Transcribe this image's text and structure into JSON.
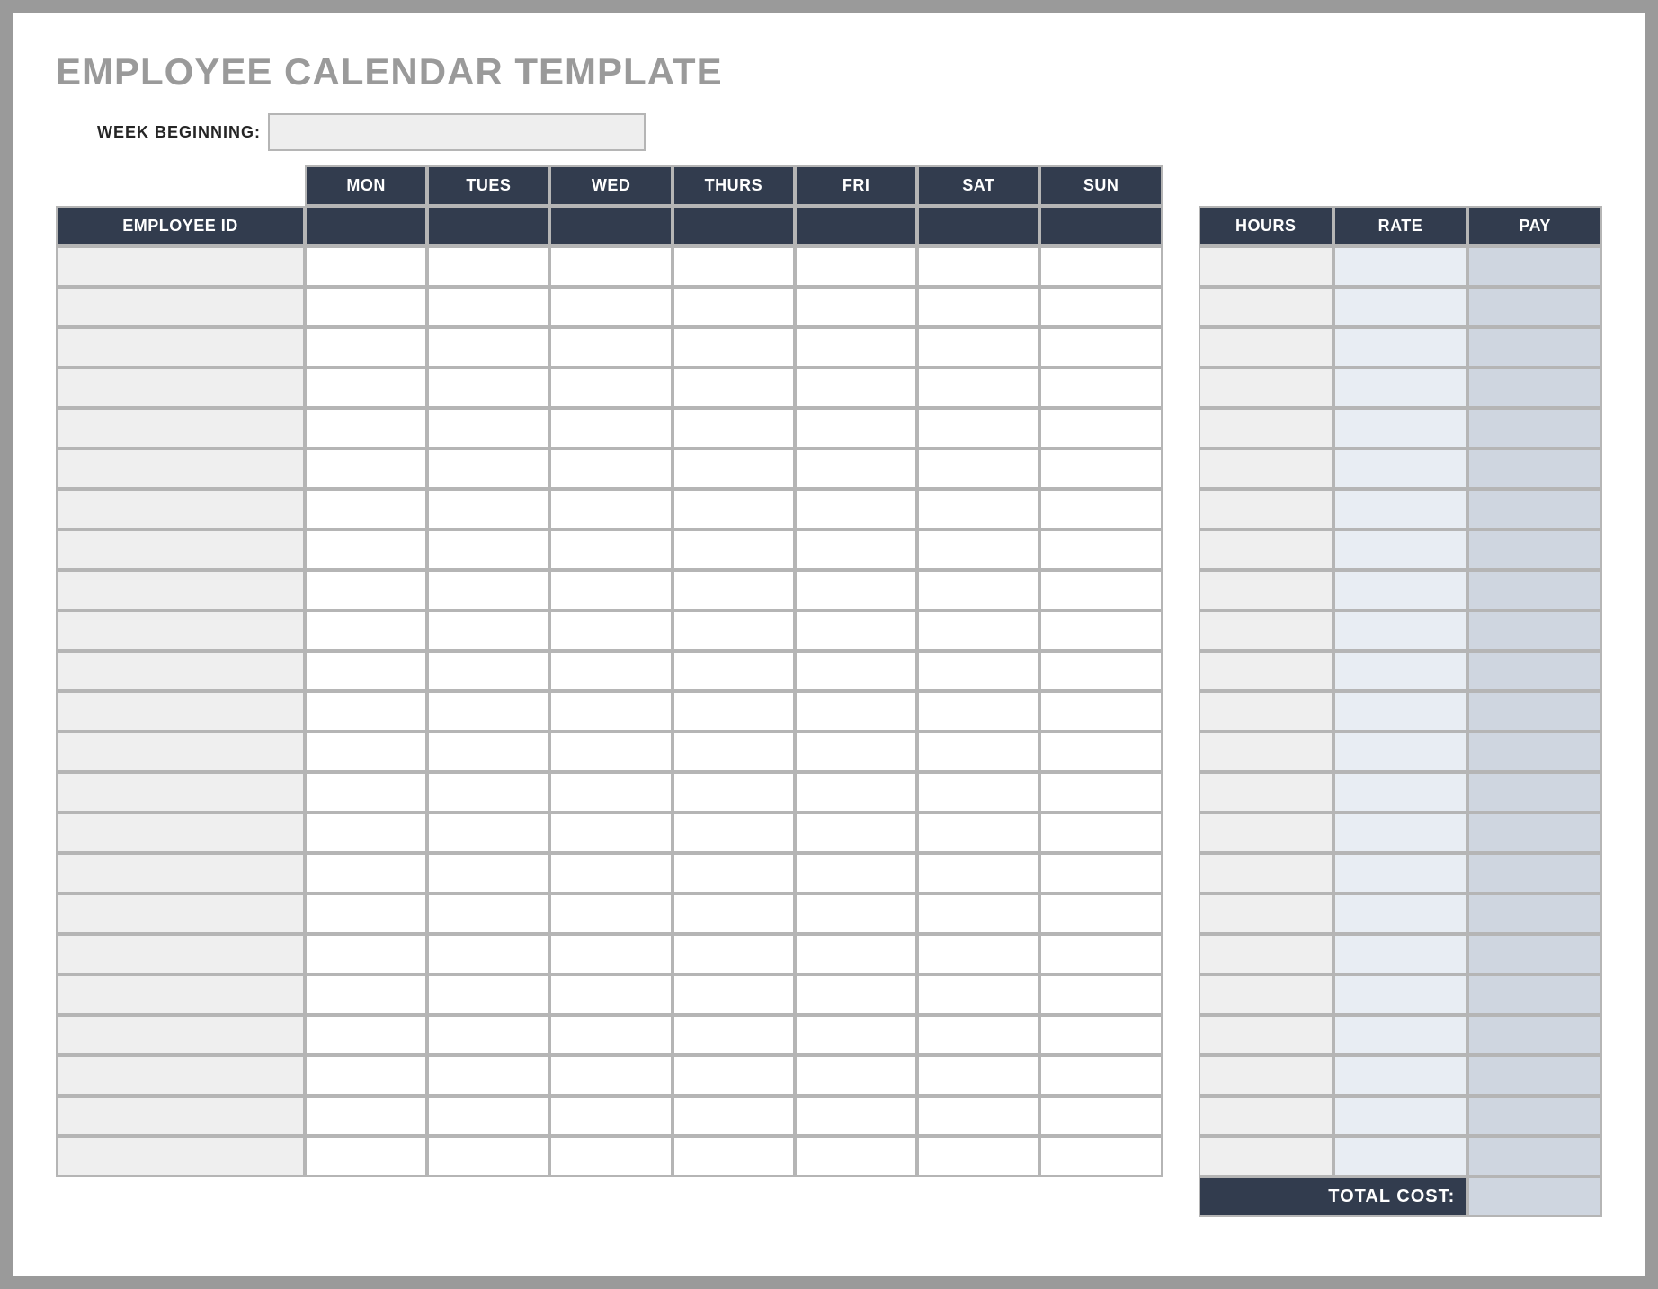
{
  "title": "EMPLOYEE CALENDAR TEMPLATE",
  "week_beginning_label": "WEEK BEGINNING:",
  "week_beginning_value": "",
  "days": [
    "MON",
    "TUES",
    "WED",
    "THURS",
    "FRI",
    "SAT",
    "SUN"
  ],
  "headers": {
    "employee_id": "EMPLOYEE ID",
    "hours": "HOURS",
    "rate": "RATE",
    "pay": "PAY"
  },
  "rows": [
    {
      "employee_id": "",
      "days": [
        "",
        "",
        "",
        "",
        "",
        "",
        ""
      ],
      "hours": "",
      "rate": "",
      "pay": ""
    },
    {
      "employee_id": "",
      "days": [
        "",
        "",
        "",
        "",
        "",
        "",
        ""
      ],
      "hours": "",
      "rate": "",
      "pay": ""
    },
    {
      "employee_id": "",
      "days": [
        "",
        "",
        "",
        "",
        "",
        "",
        ""
      ],
      "hours": "",
      "rate": "",
      "pay": ""
    },
    {
      "employee_id": "",
      "days": [
        "",
        "",
        "",
        "",
        "",
        "",
        ""
      ],
      "hours": "",
      "rate": "",
      "pay": ""
    },
    {
      "employee_id": "",
      "days": [
        "",
        "",
        "",
        "",
        "",
        "",
        ""
      ],
      "hours": "",
      "rate": "",
      "pay": ""
    },
    {
      "employee_id": "",
      "days": [
        "",
        "",
        "",
        "",
        "",
        "",
        ""
      ],
      "hours": "",
      "rate": "",
      "pay": ""
    },
    {
      "employee_id": "",
      "days": [
        "",
        "",
        "",
        "",
        "",
        "",
        ""
      ],
      "hours": "",
      "rate": "",
      "pay": ""
    },
    {
      "employee_id": "",
      "days": [
        "",
        "",
        "",
        "",
        "",
        "",
        ""
      ],
      "hours": "",
      "rate": "",
      "pay": ""
    },
    {
      "employee_id": "",
      "days": [
        "",
        "",
        "",
        "",
        "",
        "",
        ""
      ],
      "hours": "",
      "rate": "",
      "pay": ""
    },
    {
      "employee_id": "",
      "days": [
        "",
        "",
        "",
        "",
        "",
        "",
        ""
      ],
      "hours": "",
      "rate": "",
      "pay": ""
    },
    {
      "employee_id": "",
      "days": [
        "",
        "",
        "",
        "",
        "",
        "",
        ""
      ],
      "hours": "",
      "rate": "",
      "pay": ""
    },
    {
      "employee_id": "",
      "days": [
        "",
        "",
        "",
        "",
        "",
        "",
        ""
      ],
      "hours": "",
      "rate": "",
      "pay": ""
    },
    {
      "employee_id": "",
      "days": [
        "",
        "",
        "",
        "",
        "",
        "",
        ""
      ],
      "hours": "",
      "rate": "",
      "pay": ""
    },
    {
      "employee_id": "",
      "days": [
        "",
        "",
        "",
        "",
        "",
        "",
        ""
      ],
      "hours": "",
      "rate": "",
      "pay": ""
    },
    {
      "employee_id": "",
      "days": [
        "",
        "",
        "",
        "",
        "",
        "",
        ""
      ],
      "hours": "",
      "rate": "",
      "pay": ""
    },
    {
      "employee_id": "",
      "days": [
        "",
        "",
        "",
        "",
        "",
        "",
        ""
      ],
      "hours": "",
      "rate": "",
      "pay": ""
    },
    {
      "employee_id": "",
      "days": [
        "",
        "",
        "",
        "",
        "",
        "",
        ""
      ],
      "hours": "",
      "rate": "",
      "pay": ""
    },
    {
      "employee_id": "",
      "days": [
        "",
        "",
        "",
        "",
        "",
        "",
        ""
      ],
      "hours": "",
      "rate": "",
      "pay": ""
    },
    {
      "employee_id": "",
      "days": [
        "",
        "",
        "",
        "",
        "",
        "",
        ""
      ],
      "hours": "",
      "rate": "",
      "pay": ""
    },
    {
      "employee_id": "",
      "days": [
        "",
        "",
        "",
        "",
        "",
        "",
        ""
      ],
      "hours": "",
      "rate": "",
      "pay": ""
    },
    {
      "employee_id": "",
      "days": [
        "",
        "",
        "",
        "",
        "",
        "",
        ""
      ],
      "hours": "",
      "rate": "",
      "pay": ""
    },
    {
      "employee_id": "",
      "days": [
        "",
        "",
        "",
        "",
        "",
        "",
        ""
      ],
      "hours": "",
      "rate": "",
      "pay": ""
    },
    {
      "employee_id": "",
      "days": [
        "",
        "",
        "",
        "",
        "",
        "",
        ""
      ],
      "hours": "",
      "rate": "",
      "pay": ""
    }
  ],
  "total_cost_label": "TOTAL COST:",
  "total_cost_value": ""
}
